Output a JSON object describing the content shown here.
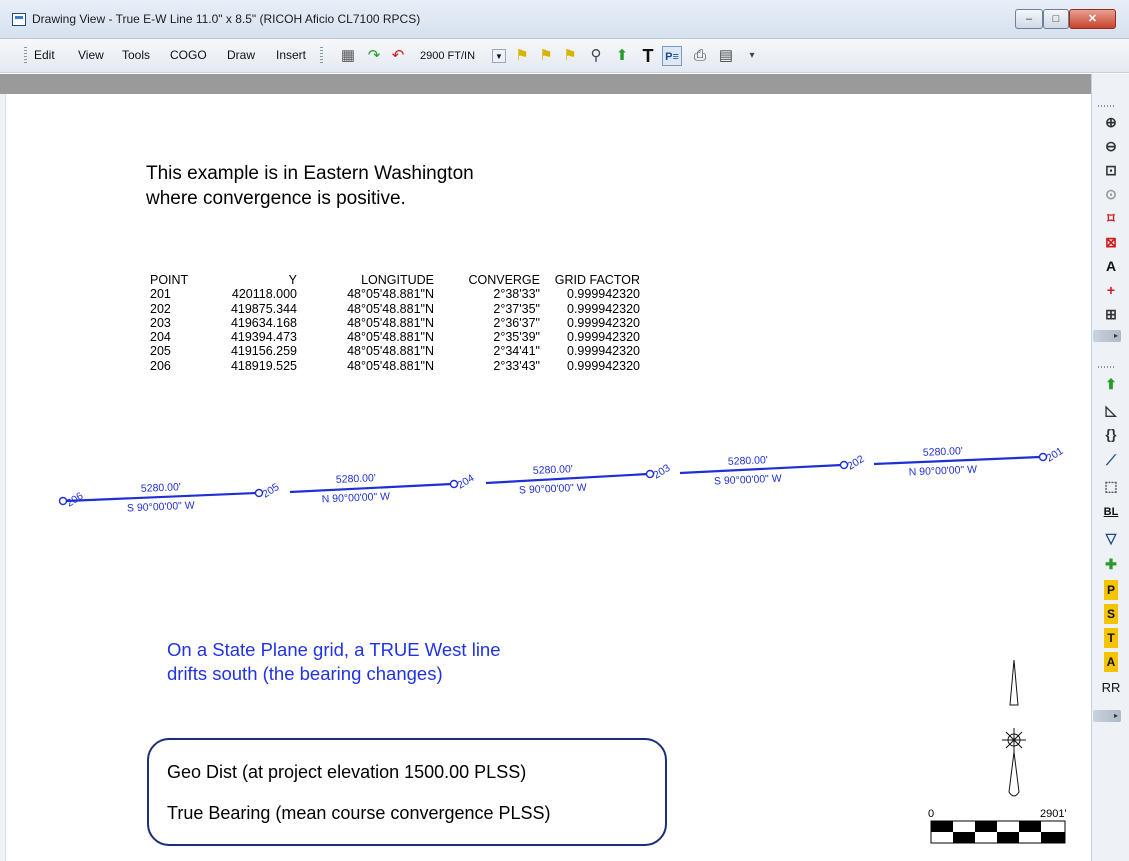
{
  "window": {
    "title": "Drawing View - True E-W Line 11.0\" x 8.5\" (RICOH Aficio CL7100 RPCS)",
    "min_glyph": "–",
    "max_glyph": "□",
    "close_glyph": "✕"
  },
  "menu": {
    "items": [
      "Edit",
      "View",
      "Tools",
      "COGO",
      "Draw",
      "Insert"
    ]
  },
  "toolbar": {
    "scale_value": "2900 FT/IN",
    "scale_arrow": "▼",
    "icons": [
      "survey-icon",
      "redo-icon",
      "undo-icon",
      "add-point-icon",
      "add-points-icon",
      "add-point-alt-icon",
      "zoom-icon",
      "extents-icon",
      "text-icon",
      "paragraph-icon",
      "print-icon",
      "plot-icon"
    ]
  },
  "right_toolbar": {
    "icons": [
      "zoom-in",
      "zoom-out",
      "zoom-window",
      "zoom-previous",
      "zoom-extents",
      "zoom-sheet",
      "text-annotate",
      "crosshair",
      "binoculars",
      "select",
      "triangle",
      "curve",
      "line-pick",
      "rectangle",
      "baseline",
      "polygon",
      "plus",
      "P",
      "S",
      "T",
      "A",
      "RR"
    ],
    "labels": {
      "bl": "BL",
      "p": "P",
      "s": "S",
      "t": "T",
      "a": "A",
      "rr": "RR"
    }
  },
  "drawing": {
    "example_line1": "This example is in Eastern Washington",
    "example_line2": "where convergence is positive.",
    "table": {
      "headers": [
        "POINT",
        "Y",
        "LONGITUDE",
        "CONVERGE",
        "GRID FACTOR"
      ],
      "rows": [
        [
          "201",
          "420118.000",
          "48°05'48.881\"N",
          "2°38'33\"",
          "0.999942320"
        ],
        [
          "202",
          "419875.344",
          "48°05'48.881\"N",
          "2°37'35\"",
          "0.999942320"
        ],
        [
          "203",
          "419634.168",
          "48°05'48.881\"N",
          "2°36'37\"",
          "0.999942320"
        ],
        [
          "204",
          "419394.473",
          "48°05'48.881\"N",
          "2°35'39\"",
          "0.999942320"
        ],
        [
          "205",
          "419156.259",
          "48°05'48.881\"N",
          "2°34'41\"",
          "0.999942320"
        ],
        [
          "206",
          "418919.525",
          "48°05'48.881\"N",
          "2°33'43\"",
          "0.999942320"
        ]
      ]
    },
    "points": [
      "206",
      "205",
      "204",
      "203",
      "202",
      "201"
    ],
    "segments": [
      {
        "distance": "5280.00'",
        "bearing": "S 90°00'00\" W"
      },
      {
        "distance": "5280.00'",
        "bearing": "N 90°00'00\" W"
      },
      {
        "distance": "5280.00'",
        "bearing": "S 90°00'00\" W"
      },
      {
        "distance": "5280.00'",
        "bearing": "S 90°00'00\" W"
      },
      {
        "distance": "5280.00'",
        "bearing": "N 90°00'00\" W"
      }
    ],
    "drift_line1": "On a State Plane grid, a TRUE West line",
    "drift_line2": "drifts south (the bearing changes)",
    "legend_line1": "Geo Dist (at project elevation 1500.00 PLSS)",
    "legend_line2": "True Bearing (mean course convergence PLSS)",
    "scale_bar": {
      "start": "0",
      "end": "2901'"
    },
    "line_color": "#1f2fd6",
    "drift_color": "#2033e6"
  }
}
